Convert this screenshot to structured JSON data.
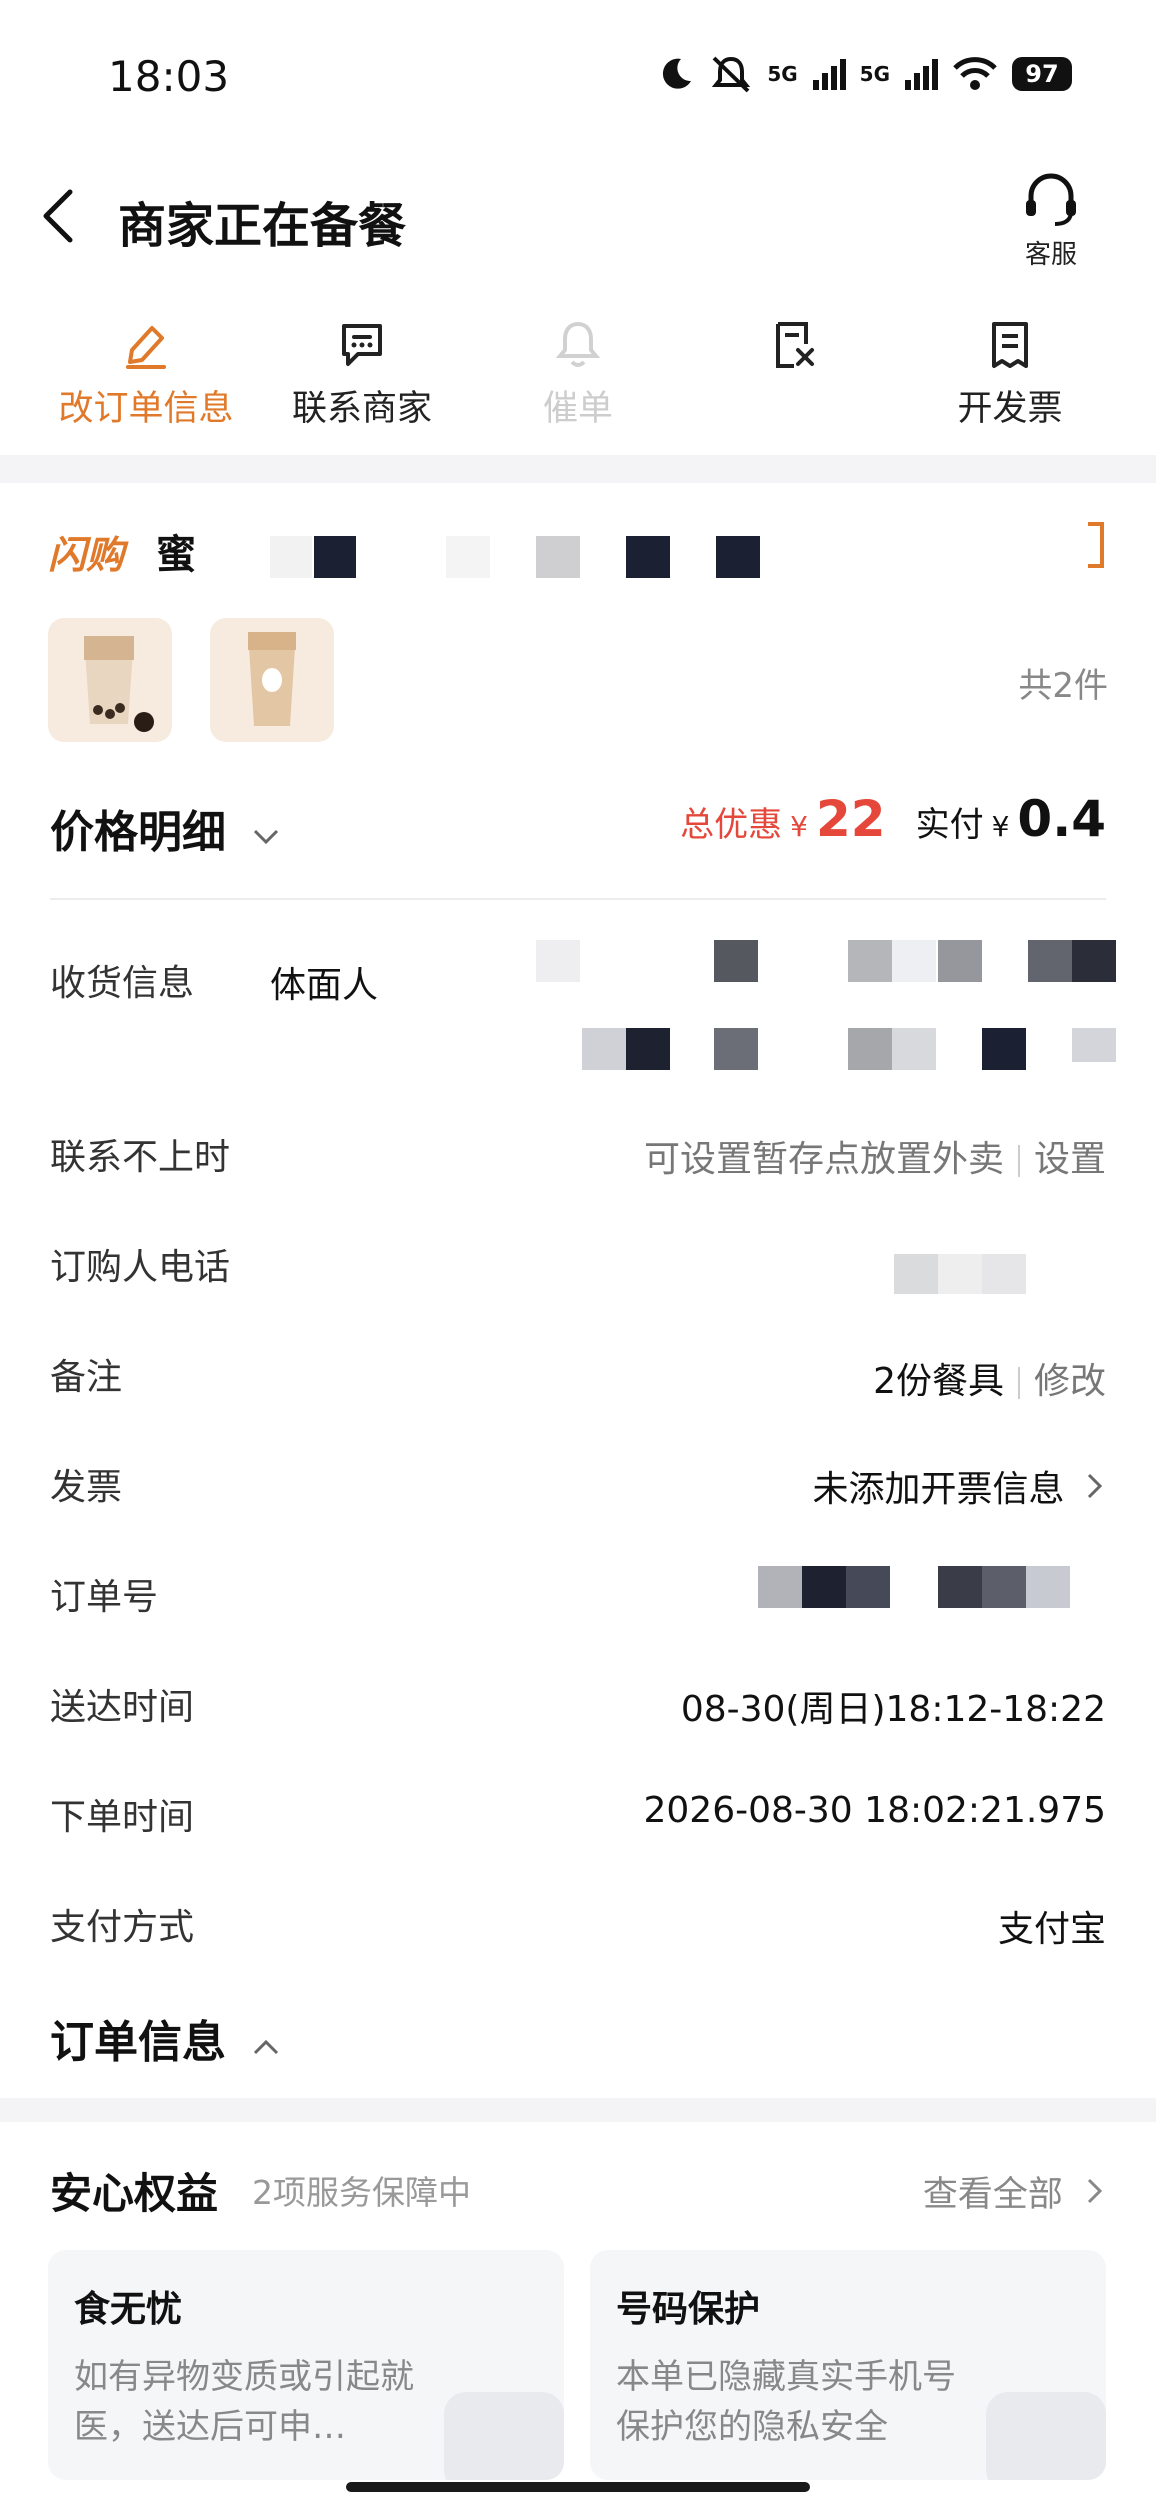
{
  "status_bar": {
    "time": "18:03",
    "battery": "97",
    "net1": "5G",
    "net2": "5G"
  },
  "header": {
    "title": "商家正在备餐",
    "service_label": "客服"
  },
  "actions": [
    {
      "label": "改订单信息",
      "icon": "edit-icon"
    },
    {
      "label": "联系商家",
      "icon": "message-icon"
    },
    {
      "label": "催单",
      "icon": "bell-icon"
    },
    {
      "label": "",
      "icon": "cancel-order-icon"
    },
    {
      "label": "开发票",
      "icon": "invoice-icon"
    }
  ],
  "shop": {
    "tag": "闪购",
    "name": "蜜"
  },
  "items": {
    "count_text": "共2件",
    "thumbs": [
      "奶茶经典",
      "椰椰系列"
    ]
  },
  "price": {
    "title": "价格明细",
    "discount_label": "总优惠",
    "discount_symbol": "¥",
    "discount_value": "22",
    "paid_label": "实付",
    "paid_symbol": "¥",
    "paid_value": "0.4"
  },
  "rows": {
    "receiver": {
      "label": "收货信息",
      "value": "体面人"
    },
    "unreachable": {
      "label": "联系不上时",
      "value": "可设置暂存点放置外卖",
      "action": "设置"
    },
    "phone": {
      "label": "订购人电话"
    },
    "note": {
      "label": "备注",
      "value": "2份餐具",
      "action": "修改"
    },
    "invoice": {
      "label": "发票",
      "value": "未添加开票信息"
    },
    "order_no": {
      "label": "订单号"
    },
    "delivery_time": {
      "label": "送达时间",
      "value": "08-30(周日)18:12-18:22"
    },
    "order_time": {
      "label": "下单时间",
      "value": "2026-08-30 18:02:21.975"
    },
    "payment": {
      "label": "支付方式",
      "value": "支付宝"
    }
  },
  "order_info": {
    "title": "订单信息"
  },
  "guarantee": {
    "title": "安心权益",
    "subtitle": "2项服务保障中",
    "view_all": "查看全部",
    "cards": [
      {
        "title": "食无忧",
        "desc": "如有异物变质或引起就医，送达后可申…"
      },
      {
        "title": "号码保护",
        "desc": "本单已隐藏真实手机号保护您的隐私安全"
      }
    ]
  }
}
